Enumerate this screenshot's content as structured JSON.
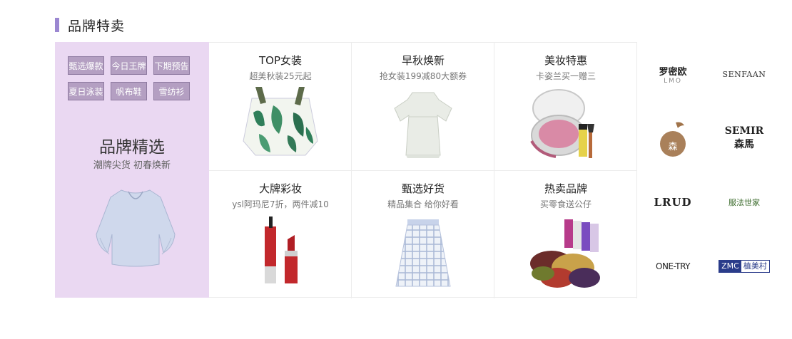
{
  "section": {
    "title": "品牌特卖"
  },
  "promo": {
    "tags": [
      "甄选爆款",
      "今日王牌",
      "下期预告",
      "夏日泳装",
      "帆布鞋",
      "雪纺衫"
    ],
    "title": "品牌精选",
    "subtitle": "潮牌尖货 初春焕新"
  },
  "cells": [
    {
      "title": "TOP女装",
      "subtitle": "超美秋装25元起"
    },
    {
      "title": "早秋焕新",
      "subtitle": "抢女装199减80大额券"
    },
    {
      "title": "美妆特惠",
      "subtitle": "卡姿兰买一赠三"
    },
    {
      "title": "大牌彩妆",
      "subtitle": "ysl阿玛尼7折，两件减10"
    },
    {
      "title": "甄选好货",
      "subtitle": "精品集合 给你好看"
    },
    {
      "title": "热卖品牌",
      "subtitle": "买零食送公仔"
    }
  ],
  "brands": {
    "luomiou": {
      "cn": "罗密欧",
      "en": "LMO"
    },
    "senfaan": "SENFAAN",
    "shu": "森",
    "semir": {
      "en": "SEMIR",
      "cn": "森馬"
    },
    "lrud": "LRUD",
    "yifa": "服法世家",
    "onetry": "ONE-TRY",
    "zmc": {
      "en": "ZMC",
      "cn": "植美村"
    }
  },
  "colors": {
    "accent": "#9b87d1",
    "promo_bg": "#ead8f2",
    "tag_bg": "#b49fc2"
  }
}
